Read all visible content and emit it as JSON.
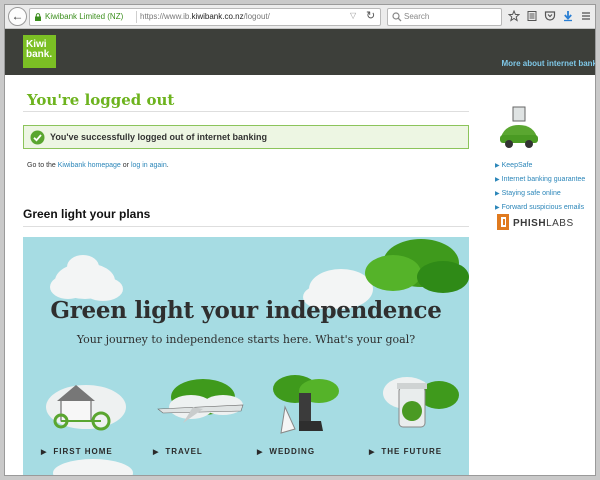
{
  "browser": {
    "back_glyph": "←",
    "ev_label": "Kiwibank Limited (NZ)",
    "url_prefix": "https://www.ib.",
    "url_domain": "kiwibank.co.nz",
    "url_suffix": "/logout/",
    "search_placeholder": "Search",
    "icons": [
      "back-icon",
      "lock-icon",
      "dropdown-icon",
      "reload-icon",
      "search-icon",
      "star-icon",
      "reader-icon",
      "pocket-icon",
      "download-icon",
      "menu-icon"
    ]
  },
  "header": {
    "logo_line1": "Kiwi",
    "logo_line2": "bank.",
    "right_link": "More about internet bank"
  },
  "main": {
    "title": "You're logged out",
    "success_message": "You've successfully logged out of internet banking",
    "goto_prefix": "Go to the",
    "homepage_link": "Kiwibank homepage",
    "goto_or": "or",
    "login_link": "log in again",
    "goto_end": ".",
    "section_heading": "Green light your plans"
  },
  "banner": {
    "title": "Green light your independence",
    "subtitle": "Your journey to independence starts here. What's your goal?",
    "categories": [
      {
        "label": "FIRST HOME"
      },
      {
        "label": "TRAVEL"
      },
      {
        "label": "WEDDING"
      },
      {
        "label": "THE FUTURE"
      }
    ]
  },
  "sidebar": {
    "links": [
      {
        "label": "KeepSafe"
      },
      {
        "label": "Internet banking guarantee"
      },
      {
        "label": "Staying safe online"
      },
      {
        "label": "Forward suspicious emails"
      }
    ],
    "partner_left": "PHISH",
    "partner_right": "LABS"
  },
  "colors": {
    "brand_green": "#7bbf24",
    "header_dark": "#3d3f3a",
    "link_blue": "#2b86b9",
    "banner_bg": "#a6dce3"
  }
}
